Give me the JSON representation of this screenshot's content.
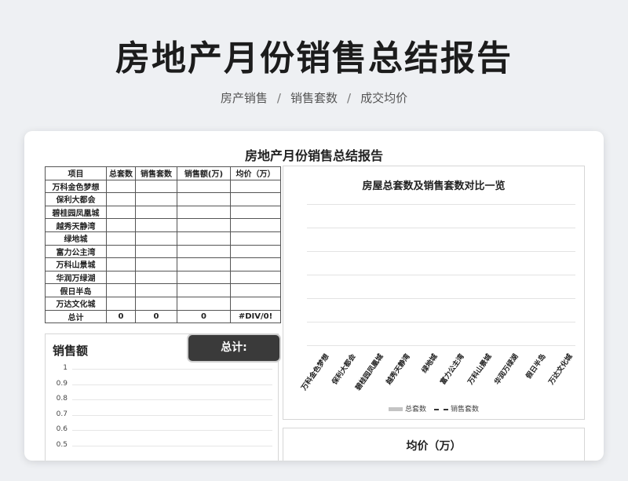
{
  "header": {
    "title": "房地产月份销售总结报告",
    "breadcrumb": [
      "房产销售",
      "销售套数",
      "成交均价"
    ],
    "separator": "/"
  },
  "sheet": {
    "title": "房地产月份销售总结报告",
    "columns": [
      "项目",
      "总套数",
      "销售套数",
      "销售额(万)",
      "均价（万）"
    ],
    "projects": [
      "万科金色梦想",
      "保利大都会",
      "碧桂园凤凰城",
      "越秀天静湾",
      "绿地城",
      "富力公主湾",
      "万科山景城",
      "华润万绿湖",
      "假日半岛",
      "万达文化城"
    ],
    "total_row": {
      "label": "总计",
      "total_units": "0",
      "sold_units": "0",
      "sales": "0",
      "avg_price": "#DIV/0!"
    }
  },
  "chart_main": {
    "title": "房屋总套数及销售套数对比一览",
    "legend": [
      "总套数",
      "销售套数"
    ]
  },
  "chart_sales": {
    "title": "销售额",
    "yticks": [
      "1",
      "0.9",
      "0.8",
      "0.7",
      "0.6",
      "0.5"
    ]
  },
  "total_button": {
    "label": "总计:"
  },
  "chart_avg": {
    "title": "均价（万）"
  },
  "chart_data": [
    {
      "type": "bar",
      "title": "房屋总套数及销售套数对比一览",
      "categories": [
        "万科金色梦想",
        "保利大都会",
        "碧桂园凤凰城",
        "越秀天静湾",
        "绿地城",
        "富力公主湾",
        "万科山景城",
        "华润万绿湖",
        "假日半岛",
        "万达文化城"
      ],
      "series": [
        {
          "name": "总套数",
          "values": [
            0,
            0,
            0,
            0,
            0,
            0,
            0,
            0,
            0,
            0
          ]
        },
        {
          "name": "销售套数",
          "values": [
            0,
            0,
            0,
            0,
            0,
            0,
            0,
            0,
            0,
            0
          ]
        }
      ],
      "grid": true,
      "legend": "bottom"
    },
    {
      "type": "line",
      "title": "销售额",
      "yticks": [
        1,
        0.9,
        0.8,
        0.7,
        0.6,
        0.5
      ],
      "grid": true
    }
  ],
  "colors": {
    "bar": "#c4c4c4",
    "line": "#333333",
    "button": "#3a3a3a"
  }
}
